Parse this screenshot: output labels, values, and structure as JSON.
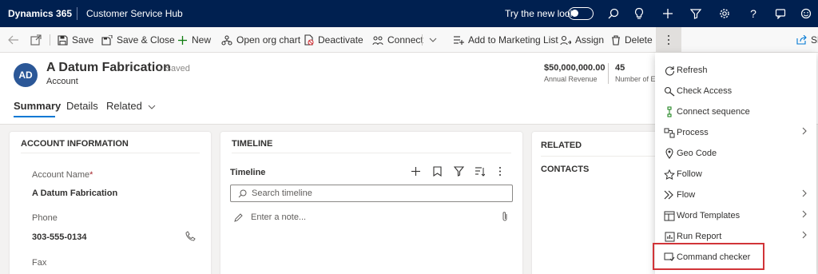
{
  "topbar": {
    "brand": "Dynamics 365",
    "app_name": "Customer Service Hub",
    "try_new_look": "Try the new look",
    "icons": [
      "search-icon",
      "lightbulb-icon",
      "plus-icon",
      "filter-icon",
      "gear-icon",
      "help-icon",
      "chat-icon",
      "feedback-icon"
    ]
  },
  "commandbar": {
    "save": "Save",
    "save_close": "Save & Close",
    "new": "New",
    "org_chart": "Open org chart",
    "deactivate": "Deactivate",
    "connect": "Connect",
    "add_marketing": "Add to Marketing List",
    "assign": "Assign",
    "delete": "Delete",
    "share": "Sh"
  },
  "record": {
    "initials": "AD",
    "title": "A Datum Fabrication",
    "saved": "- Saved",
    "entity": "Account",
    "kpis": [
      {
        "value": "$50,000,000.00",
        "label": "Annual Revenue"
      },
      {
        "value": "45",
        "label": "Number of Em"
      }
    ],
    "tabs": [
      "Summary",
      "Details",
      "Related"
    ]
  },
  "account_info": {
    "heading": "ACCOUNT INFORMATION",
    "fields": [
      {
        "label": "Account Name",
        "required": "*",
        "value": "A Datum Fabrication"
      },
      {
        "label": "Phone",
        "value": "303-555-0134"
      },
      {
        "label": "Fax",
        "value": ""
      }
    ]
  },
  "timeline": {
    "heading": "TIMELINE",
    "subheading": "Timeline",
    "search_placeholder": "Search timeline",
    "note_placeholder": "Enter a note..."
  },
  "related": {
    "heading": "RELATED",
    "contacts": "CONTACTS"
  },
  "more_menu": {
    "items": [
      {
        "label": "Refresh",
        "icon": "refresh-icon",
        "submenu": false
      },
      {
        "label": "Check Access",
        "icon": "check-access-icon",
        "submenu": false
      },
      {
        "label": "Connect sequence",
        "icon": "sequence-icon",
        "submenu": false
      },
      {
        "label": "Process",
        "icon": "process-icon",
        "submenu": true
      },
      {
        "label": "Geo Code",
        "icon": "location-pin-icon",
        "submenu": false
      },
      {
        "label": "Follow",
        "icon": "star-icon",
        "submenu": false
      },
      {
        "label": "Flow",
        "icon": "flow-icon",
        "submenu": true
      },
      {
        "label": "Word Templates",
        "icon": "word-icon",
        "submenu": true
      },
      {
        "label": "Run Report",
        "icon": "report-icon",
        "submenu": true
      },
      {
        "label": "Command checker",
        "icon": "command-checker-icon",
        "submenu": false
      }
    ],
    "highlighted_item": "Command checker"
  },
  "colors": {
    "topbar_bg": "#002050",
    "accent": "#0078d4",
    "avatar": "#2b5797",
    "highlight_border": "#d13438"
  }
}
